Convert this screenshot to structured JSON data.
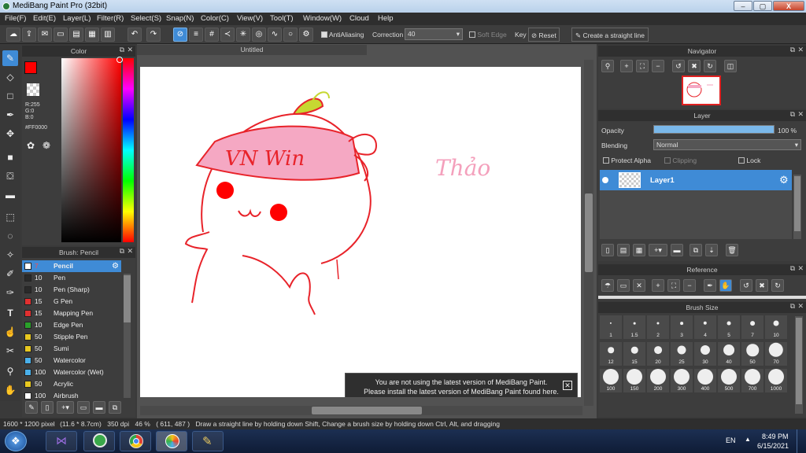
{
  "window": {
    "title": "MediBang Paint Pro (32bit)",
    "close_glyph": "X",
    "min_glyph": "–",
    "max_glyph": "▢"
  },
  "menu": [
    "File(F)",
    "Edit(E)",
    "Layer(L)",
    "Filter(R)",
    "Select(S)",
    "Snap(N)",
    "Color(C)",
    "View(V)",
    "Tool(T)",
    "Window(W)",
    "Cloud",
    "Help"
  ],
  "toolbar": {
    "antialias_label": "AntiAliasing",
    "correction_label": "Correction",
    "correction_value": "40",
    "soft_edge_label": "Soft Edge",
    "key_label": "Key",
    "reset_label": "Reset",
    "straight_line_label": "Create a straight line"
  },
  "color_panel": {
    "title": "Color",
    "current_color": "#FF0000",
    "r": "R:255",
    "g": "G:0",
    "b": "B:0",
    "hex": "#FF0000"
  },
  "canvas": {
    "tab_title": "Untitled"
  },
  "brush_panel": {
    "title": "Brush: Pencil",
    "items": [
      {
        "size": "7",
        "name": "Pencil",
        "color": "#ffffff",
        "selected": true
      },
      {
        "size": "10",
        "name": "Pen",
        "color": "#2a2a2a"
      },
      {
        "size": "10",
        "name": "Pen (Sharp)",
        "color": "#2a2a2a"
      },
      {
        "size": "15",
        "name": "G Pen",
        "color": "#e03030"
      },
      {
        "size": "15",
        "name": "Mapping Pen",
        "color": "#e03030"
      },
      {
        "size": "10",
        "name": "Edge Pen",
        "color": "#2aa02a"
      },
      {
        "size": "50",
        "name": "Stipple Pen",
        "color": "#e8c820"
      },
      {
        "size": "50",
        "name": "Sumi",
        "color": "#e8c820"
      },
      {
        "size": "50",
        "name": "Watercolor",
        "color": "#4ab0ea"
      },
      {
        "size": "100",
        "name": "Watercolor (Wet)",
        "color": "#4ab0ea"
      },
      {
        "size": "50",
        "name": "Acrylic",
        "color": "#e8c820"
      },
      {
        "size": "100",
        "name": "Airbrush",
        "color": "#ffffff"
      }
    ]
  },
  "navigator": {
    "title": "Navigator"
  },
  "layer_panel": {
    "title": "Layer",
    "opacity_label": "Opacity",
    "opacity_value": "100 %",
    "opacity_fraction": 1.0,
    "blending_label": "Blending",
    "blending_value": "Normal",
    "protect_alpha": "Protect Alpha",
    "clipping": "Clipping",
    "lock": "Lock",
    "layer_name": "Layer1"
  },
  "reference": {
    "title": "Reference"
  },
  "brush_size": {
    "title": "Brush Size",
    "sizes": [
      "1",
      "1.5",
      "2",
      "3",
      "4",
      "5",
      "7",
      "10",
      "12",
      "15",
      "20",
      "25",
      "30",
      "40",
      "50",
      "70",
      "100",
      "150",
      "200",
      "300",
      "400",
      "500",
      "700",
      "1000"
    ]
  },
  "notice": {
    "line1": "You are not using the latest version of MediBang Paint.",
    "line2": "Please install the latest version of MediBang Paint found here."
  },
  "drawing": {
    "band_text": "VN Win",
    "signature": "Thảo"
  },
  "status": {
    "size": "1600 * 1200 pixel",
    "cm": "(11.6 * 8.7cm)",
    "dpi": "350 dpi",
    "zoom": "46 %",
    "coords": "( 611, 487 )",
    "hint": "Draw a straight line by holding down Shift, Change a brush size by holding down Ctrl, Alt, and dragging"
  },
  "taskbar": {
    "lang": "EN",
    "time": "8:49 PM",
    "date": "6/15/2021"
  }
}
